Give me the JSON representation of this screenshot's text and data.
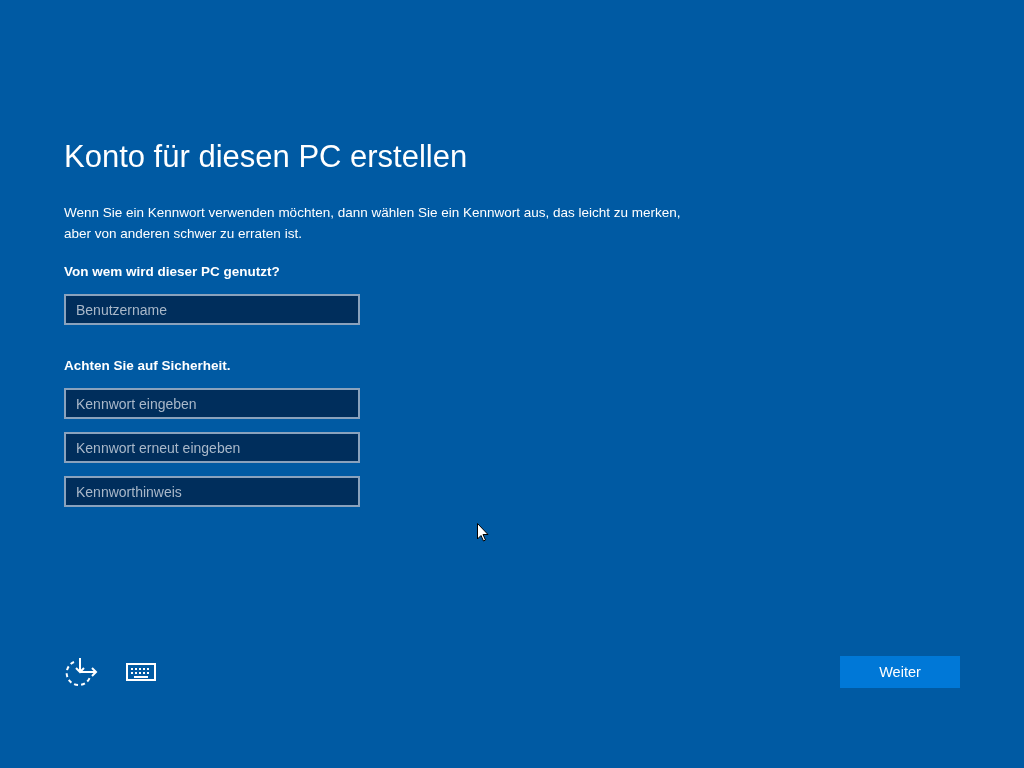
{
  "title": "Konto für diesen PC erstellen",
  "intro": "Wenn Sie ein Kennwort verwenden möchten, dann wählen Sie ein Kennwort aus, das leicht zu merken,\naber von anderen schwer zu erraten ist.",
  "sections": [
    {
      "heading": "Von wem wird dieser PC genutzt?",
      "fields": [
        {
          "placeholder": "Benutzername"
        }
      ]
    },
    {
      "heading": "Achten Sie auf Sicherheit.",
      "fields": [
        {
          "placeholder": "Kennwort eingeben"
        },
        {
          "placeholder": "Kennwort erneut eingeben"
        },
        {
          "placeholder": "Kennworthinweis"
        }
      ]
    }
  ],
  "footer": {
    "button": "Weiter"
  }
}
